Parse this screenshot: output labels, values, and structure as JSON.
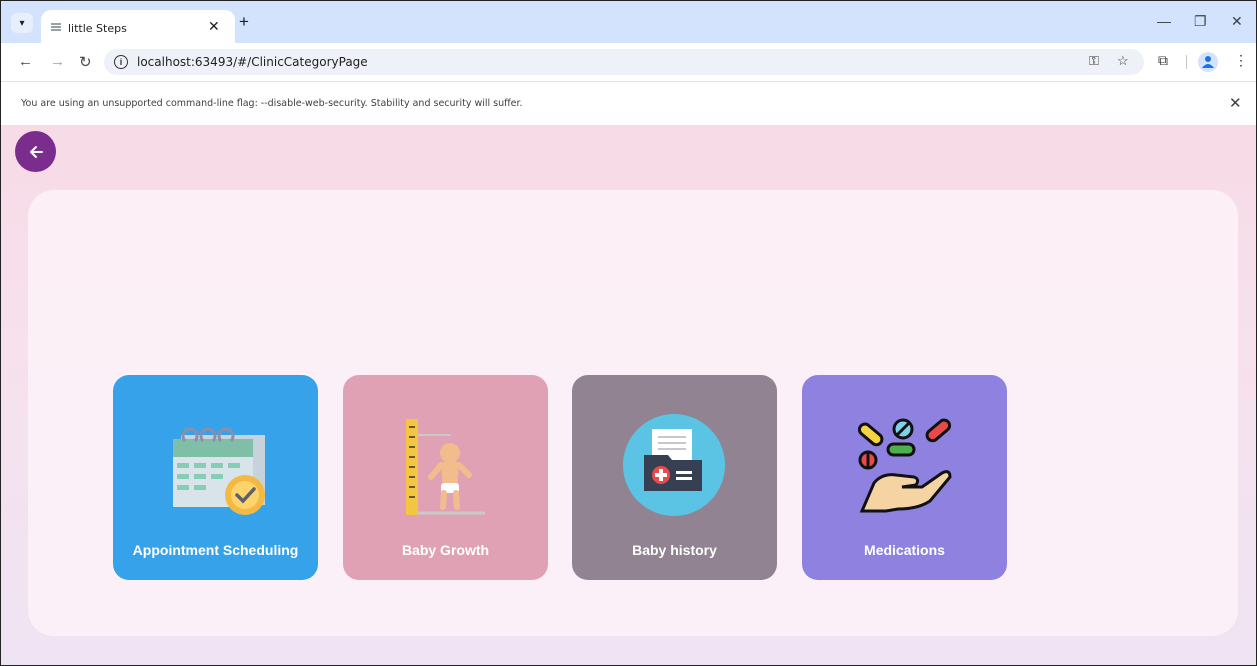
{
  "browser": {
    "tab_title": "little Steps",
    "url": "localhost:63493/#/ClinicCategoryPage",
    "infobar_text": "You are using an unsupported command-line flag: --disable-web-security. Stability and security will suffer."
  },
  "page": {
    "categories": [
      {
        "label": "Appointment Scheduling",
        "icon": "calendar-clock-icon",
        "color": "#35a2ea"
      },
      {
        "label": "Baby Growth",
        "icon": "baby-height-icon",
        "color": "#e1a1b5"
      },
      {
        "label": "Baby history",
        "icon": "medical-folder-icon",
        "color": "#928393"
      },
      {
        "label": "Medications",
        "icon": "pills-hand-icon",
        "color": "#8f81e0"
      }
    ]
  },
  "colors": {
    "back_button": "#7b2d8e",
    "tabstrip": "#d3e3fd"
  }
}
